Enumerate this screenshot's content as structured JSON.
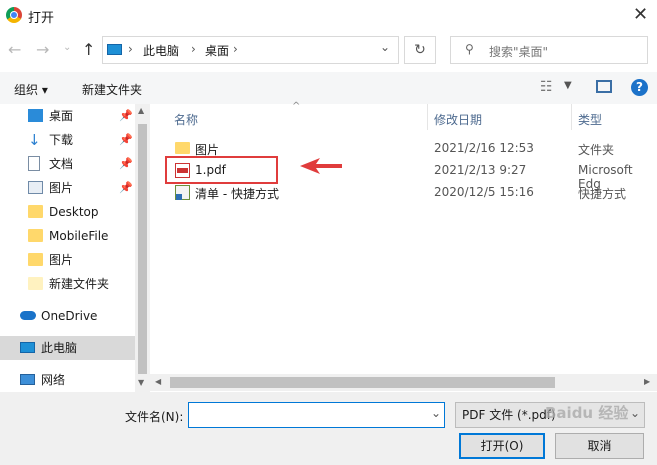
{
  "window": {
    "title": "打开"
  },
  "address": {
    "path": [
      "此电脑",
      "桌面"
    ],
    "search_placeholder": "搜索\"桌面\""
  },
  "toolbar": {
    "organize": "组织 ▾",
    "new_folder": "新建文件夹"
  },
  "nav": {
    "items": [
      {
        "label": "桌面",
        "pinned": true
      },
      {
        "label": "下载",
        "pinned": true
      },
      {
        "label": "文档",
        "pinned": true
      },
      {
        "label": "图片",
        "pinned": true
      },
      {
        "label": "Desktop"
      },
      {
        "label": "MobileFile"
      },
      {
        "label": "图片"
      },
      {
        "label": "新建文件夹"
      },
      {
        "label": "OneDrive"
      },
      {
        "label": "此电脑",
        "selected": true
      },
      {
        "label": "网络"
      }
    ]
  },
  "files": {
    "columns": [
      "名称",
      "修改日期",
      "类型"
    ],
    "rows": [
      {
        "name": "图片",
        "date": "2021/2/16 12:53",
        "type": "文件夹"
      },
      {
        "name": "1.pdf",
        "date": "2021/2/13 9:27",
        "type": "Microsoft Edg"
      },
      {
        "name": "清单 - 快捷方式",
        "date": "2020/12/5 15:16",
        "type": "快捷方式"
      }
    ]
  },
  "bottom": {
    "filename_label": "文件名(N):",
    "filename_value": "",
    "filetype": "PDF 文件 (*.pdf)",
    "open": "打开(O)",
    "cancel": "取消"
  },
  "watermark": "Baidu 经验",
  "colors": {
    "accent": "#0078d7",
    "annotation": "#e03c3c"
  }
}
